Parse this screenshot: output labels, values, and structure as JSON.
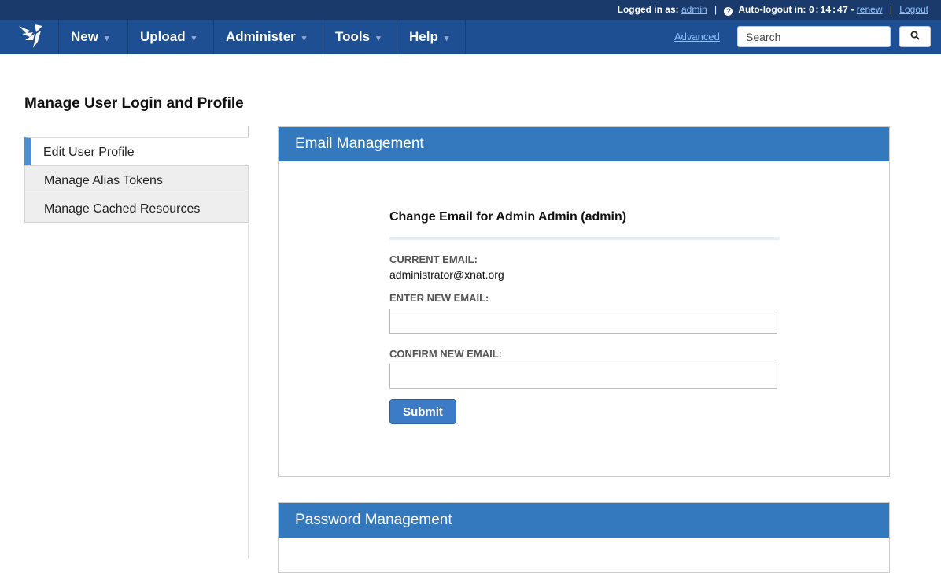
{
  "topbar": {
    "logged_in_label": "Logged in as:",
    "username": "admin",
    "autologout_label": "Auto-logout in:",
    "countdown": "0:14:47",
    "renew_label": "renew",
    "logout_label": "Logout",
    "help_icon": "question-circle-icon"
  },
  "nav": {
    "logo_icon": "xnat-logo-icon",
    "items": [
      {
        "label": "New"
      },
      {
        "label": "Upload"
      },
      {
        "label": "Administer"
      },
      {
        "label": "Tools"
      },
      {
        "label": "Help"
      }
    ],
    "advanced_label": "Advanced",
    "search_placeholder": "Search",
    "search_icon": "search-icon"
  },
  "page": {
    "title": "Manage User Login and Profile"
  },
  "sidebar": {
    "tabs": [
      {
        "label": "Edit User Profile",
        "active": true
      },
      {
        "label": "Manage Alias Tokens",
        "active": false
      },
      {
        "label": "Manage Cached Resources",
        "active": false
      }
    ]
  },
  "email_panel": {
    "title": "Email Management",
    "heading": "Change Email for Admin Admin (admin)",
    "current_label": "CURRENT EMAIL:",
    "current_value": "administrator@xnat.org",
    "new_label": "ENTER NEW EMAIL:",
    "new_value": "",
    "confirm_label": "CONFIRM NEW EMAIL:",
    "confirm_value": "",
    "submit_label": "Submit"
  },
  "password_panel": {
    "title": "Password Management"
  },
  "colors": {
    "topbar": "#1a3a6b",
    "navbar": "#1d4f92",
    "panel_header": "#3479be",
    "active_tab_accent": "#4a90d9",
    "submit": "#3c7cc7"
  }
}
